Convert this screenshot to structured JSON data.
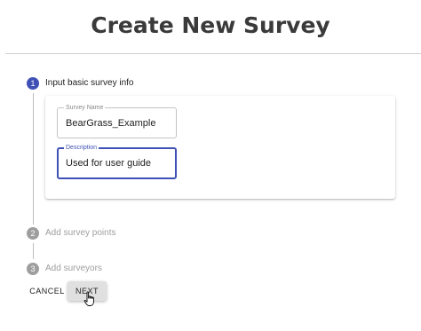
{
  "page": {
    "title": "Create New Survey"
  },
  "steps": [
    {
      "number": "1",
      "label": "Input basic survey info",
      "state": "active"
    },
    {
      "number": "2",
      "label": "Add survey points",
      "state": "inactive"
    },
    {
      "number": "3",
      "label": "Add surveyors",
      "state": "inactive"
    }
  ],
  "form": {
    "survey_name": {
      "label": "Survey Name",
      "value": "BearGrass_Example"
    },
    "description": {
      "label": "Description",
      "value": "Used for user guide"
    }
  },
  "actions": {
    "cancel_label": "CANCEL",
    "next_label": "NEXT"
  },
  "colors": {
    "accent": "#3f51b5",
    "inactive": "#9e9e9e"
  },
  "icons": {
    "cursor": "hand-pointer-icon"
  }
}
